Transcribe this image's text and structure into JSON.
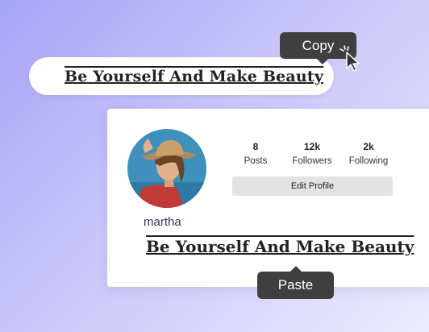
{
  "copy_field": {
    "text": "Be Yourself And Make Beauty"
  },
  "tooltips": {
    "copy_label": "Copy",
    "paste_label": "Paste"
  },
  "profile": {
    "stats": [
      {
        "value": "8",
        "label": "Posts"
      },
      {
        "value": "12k",
        "label": "Followers"
      },
      {
        "value": "2k",
        "label": "Following"
      }
    ],
    "edit_button_label": "Edit Profile",
    "username": "martha",
    "bio": "Be Yourself And Make Beauty"
  },
  "colors": {
    "tooltip_bg": "#3f3f3f",
    "card_bg": "#ffffff",
    "button_bg": "#e3e3e3"
  },
  "icons": [
    "mouse-cursor-icon",
    "click-burst-icon"
  ]
}
